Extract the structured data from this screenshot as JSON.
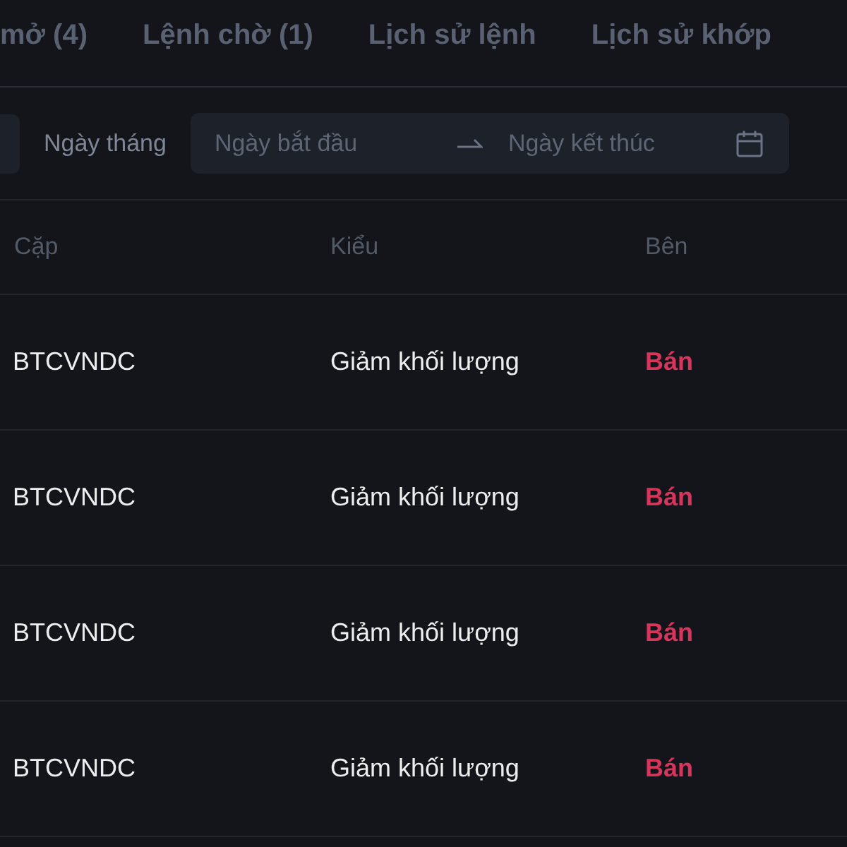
{
  "tabs": [
    {
      "label": "mở (4)",
      "selected": false
    },
    {
      "label": "Lệnh chờ (1)",
      "selected": false
    },
    {
      "label": "Lịch sử lệnh",
      "selected": false
    },
    {
      "label": "Lịch sử khớp",
      "selected": false
    }
  ],
  "filter": {
    "label": "Ngày tháng",
    "start_placeholder": "Ngày bắt đầu",
    "end_placeholder": "Ngày kết thúc"
  },
  "table": {
    "columns": [
      "Cặp",
      "Kiểu",
      "Bên"
    ],
    "rows": [
      {
        "pair": "BTCVNDC",
        "type": "Giảm khối lượng",
        "side": {
          "text": "Bán",
          "kind": "sell"
        }
      },
      {
        "pair": "BTCVNDC",
        "type": "Giảm khối lượng",
        "side": {
          "text": "Bán",
          "kind": "sell"
        }
      },
      {
        "pair": "BTCVNDC",
        "type": "Giảm khối lượng",
        "side": {
          "text": "Bán",
          "kind": "sell"
        }
      },
      {
        "pair": "BTCVNDC",
        "type": "Giảm khối lượng",
        "side": {
          "text": "Bán",
          "kind": "sell"
        }
      }
    ]
  }
}
